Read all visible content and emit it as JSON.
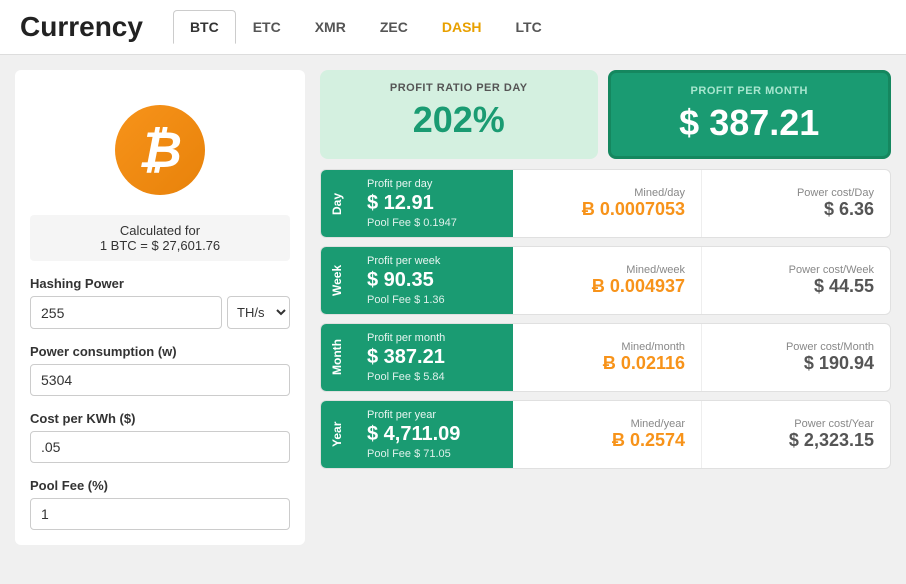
{
  "header": {
    "title": "Currency",
    "tabs": [
      {
        "label": "BTC",
        "active": true,
        "special": false
      },
      {
        "label": "ETC",
        "active": false,
        "special": false
      },
      {
        "label": "XMR",
        "active": false,
        "special": false
      },
      {
        "label": "ZEC",
        "active": false,
        "special": false
      },
      {
        "label": "DASH",
        "active": false,
        "special": "dash"
      },
      {
        "label": "LTC",
        "active": false,
        "special": false
      }
    ]
  },
  "left": {
    "calc_for_label": "Calculated for",
    "calc_for_value": "1 BTC = $ 27,601.76",
    "hashing_label": "Hashing Power",
    "hashing_value": "255",
    "hashing_unit": "TH/s",
    "power_label": "Power consumption (w)",
    "power_value": "5304",
    "cost_label": "Cost per KWh ($)",
    "cost_value": ".05",
    "pool_label": "Pool Fee (%)",
    "pool_value": "1"
  },
  "summary": {
    "ratio_label": "PROFIT RATIO PER DAY",
    "ratio_value": "202%",
    "monthly_label": "PROFIT PER MONTH",
    "monthly_value": "$ 387.21"
  },
  "periods": [
    {
      "label": "Day",
      "profit_title": "Profit per day",
      "profit_amount": "$ 12.91",
      "pool_fee": "Pool Fee $ 0.1947",
      "mined_label": "Mined/day",
      "mined_value": "Ƀ 0.0007053",
      "power_label": "Power cost/Day",
      "power_value": "$ 6.36"
    },
    {
      "label": "Week",
      "profit_title": "Profit per week",
      "profit_amount": "$ 90.35",
      "pool_fee": "Pool Fee $ 1.36",
      "mined_label": "Mined/week",
      "mined_value": "Ƀ 0.004937",
      "power_label": "Power cost/Week",
      "power_value": "$ 44.55"
    },
    {
      "label": "Month",
      "profit_title": "Profit per month",
      "profit_amount": "$ 387.21",
      "pool_fee": "Pool Fee $ 5.84",
      "mined_label": "Mined/month",
      "mined_value": "Ƀ 0.02116",
      "power_label": "Power cost/Month",
      "power_value": "$ 190.94"
    },
    {
      "label": "Year",
      "profit_title": "Profit per year",
      "profit_amount": "$ 4,711.09",
      "pool_fee": "Pool Fee $ 71.05",
      "mined_label": "Mined/year",
      "mined_value": "Ƀ 0.2574",
      "power_label": "Power cost/Year",
      "power_value": "$ 2,323.15"
    }
  ],
  "icons": {
    "bitcoin": "₿"
  }
}
